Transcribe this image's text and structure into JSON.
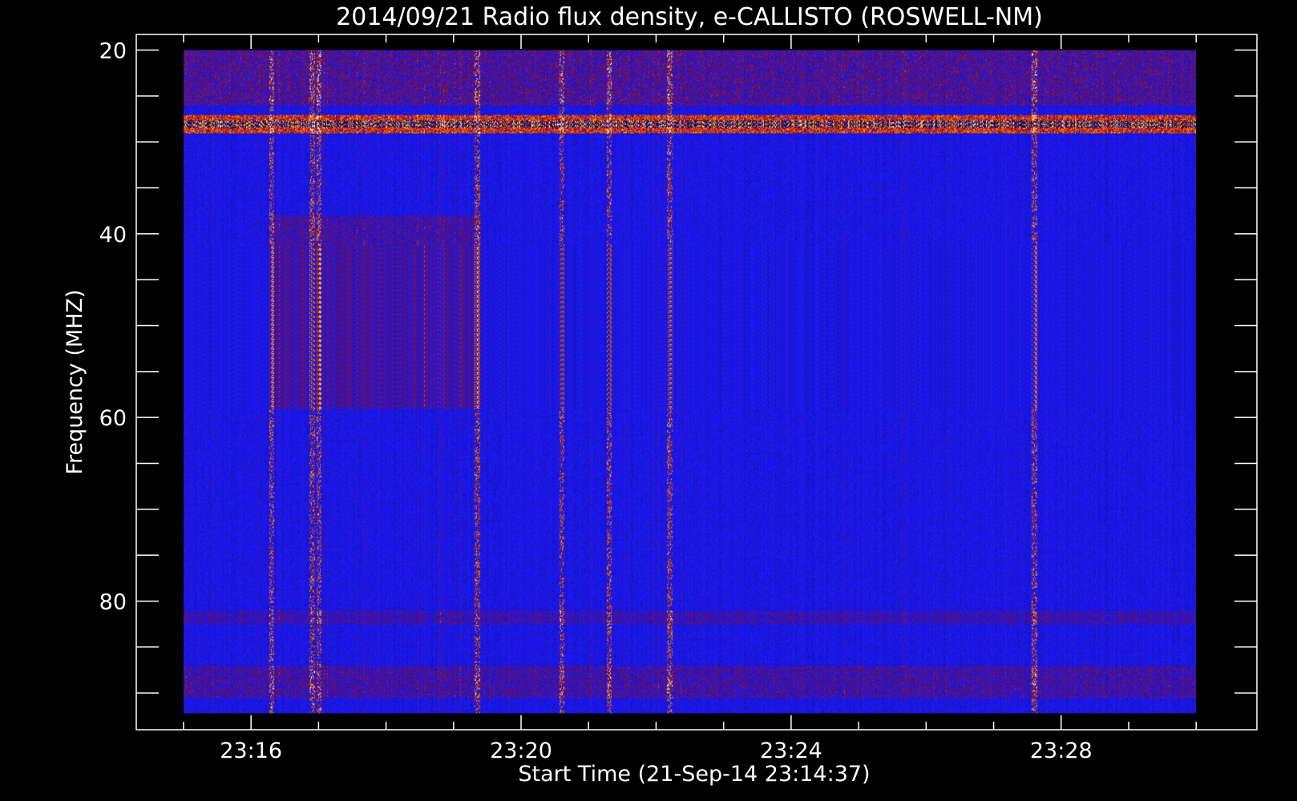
{
  "chart_data": {
    "type": "heatmap",
    "title": "2014/09/21  Radio flux density, e-CALLISTO (ROSWELL-NM)",
    "xlabel": "Start Time (21-Sep-14 23:14:37)",
    "ylabel": "Frequency (MHZ)",
    "x_ticks": [
      "23:16",
      "23:20",
      "23:24",
      "23:28"
    ],
    "x_tick_minutes": [
      16,
      20,
      24,
      28
    ],
    "x_range_minutes": [
      14.3,
      30.9
    ],
    "y_ticks": [
      20,
      40,
      60,
      80
    ],
    "ylim": [
      18.3,
      94
    ],
    "data_extent": {
      "time_minutes": [
        15.0,
        30.0
      ],
      "freq_mhz": [
        20,
        92.2
      ]
    },
    "colormap": [
      "#000000",
      "#1a1aff",
      "#8a0a1a",
      "#ff4400",
      "#ffcc00",
      "#ffffff"
    ],
    "background_color": "#2222ee",
    "features": [
      {
        "name": "interference band",
        "freq_mhz": [
          27.0,
          29.0
        ],
        "time_minutes": [
          15.0,
          30.0
        ],
        "intensity": 0.9
      },
      {
        "name": "upper emission",
        "freq_mhz": [
          20.0,
          26.0
        ],
        "time_minutes": [
          15.0,
          30.0
        ],
        "intensity": 0.5
      },
      {
        "name": "burst patch",
        "freq_mhz": [
          38.0,
          59.0
        ],
        "time_minutes": [
          16.3,
          19.4
        ],
        "intensity": 0.45
      },
      {
        "name": "lower band",
        "freq_mhz": [
          81.0,
          82.5
        ],
        "time_minutes": [
          15.0,
          30.0
        ],
        "intensity": 0.4
      },
      {
        "name": "lower band",
        "freq_mhz": [
          87.0,
          90.5
        ],
        "time_minutes": [
          15.0,
          30.0
        ],
        "intensity": 0.45
      }
    ],
    "bright_columns_minutes": [
      16.3,
      16.9,
      17.0,
      19.35,
      20.6,
      21.3,
      22.2,
      27.6
    ]
  }
}
